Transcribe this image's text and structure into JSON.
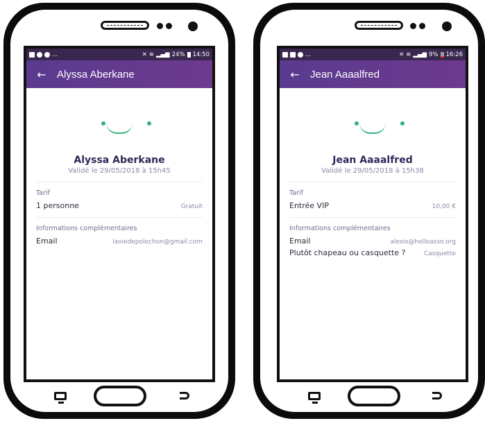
{
  "phones": [
    {
      "status": {
        "left_extra": "...",
        "battery": "24%",
        "time": "14:50"
      },
      "appbar": {
        "title": "Alyssa Aberkane"
      },
      "participant": {
        "name": "Alyssa Aberkane",
        "validated": "Validé le 29/05/2018 à 15h45"
      },
      "tarif": {
        "label": "Tarif",
        "name": "1 personne",
        "price": "Gratuit"
      },
      "info": {
        "label": "Informations complémentaires",
        "rows": [
          {
            "key": "Email",
            "value": "laviedepolochon@gmail.com"
          }
        ]
      }
    },
    {
      "status": {
        "left_extra": "...",
        "battery": "9%",
        "time": "16:26"
      },
      "appbar": {
        "title": "Jean Aaaalfred"
      },
      "participant": {
        "name": "Jean Aaaalfred",
        "validated": "Validé le 29/05/2018 à 15h38"
      },
      "tarif": {
        "label": "Tarif",
        "name": "Entrée VIP",
        "price": "10,00 €"
      },
      "info": {
        "label": "Informations complémentaires",
        "rows": [
          {
            "key": "Email",
            "value": "alexis@helloasso.org"
          },
          {
            "key": "Plutôt chapeau ou casquette ?",
            "value": "Casquette"
          }
        ]
      }
    }
  ],
  "colors": {
    "accent": "#2fb37a",
    "appbar": "#5a3b8f",
    "title": "#2c2a58"
  },
  "icons": {
    "back": "arrow-left-icon",
    "home": "home-button",
    "recent": "recent-apps-icon",
    "return": "back-nav-icon"
  }
}
